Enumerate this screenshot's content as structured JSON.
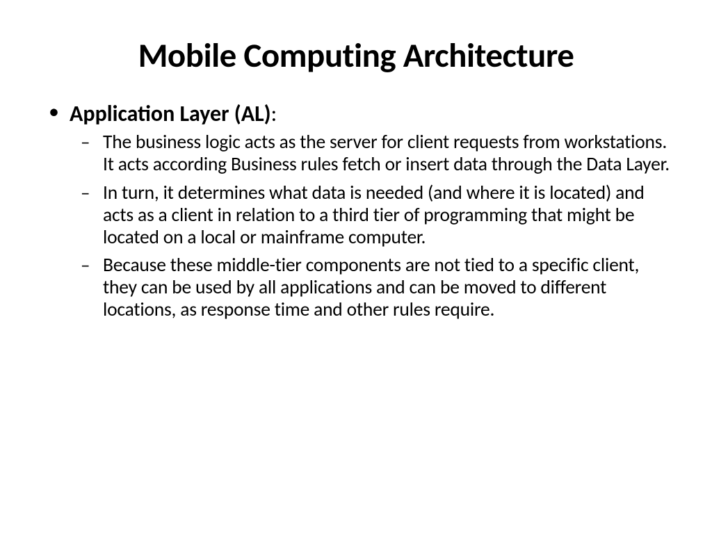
{
  "slide": {
    "title": "Mobile Computing Architecture",
    "main_bullet": {
      "heading": "Application Layer (AL)",
      "colon": ":",
      "sub_bullets": [
        "The business logic acts as the server for client requests from workstations. It acts according Business rules fetch or insert data through the Data Layer.",
        "In turn, it determines what data is needed (and where it is located) and acts as a client in relation to a third tier of programming that might be located on a local or mainframe computer.",
        "Because these middle-tier components are not tied to a specific client, they can be used by all applications and can be moved to different locations, as response time and other rules require."
      ]
    }
  }
}
